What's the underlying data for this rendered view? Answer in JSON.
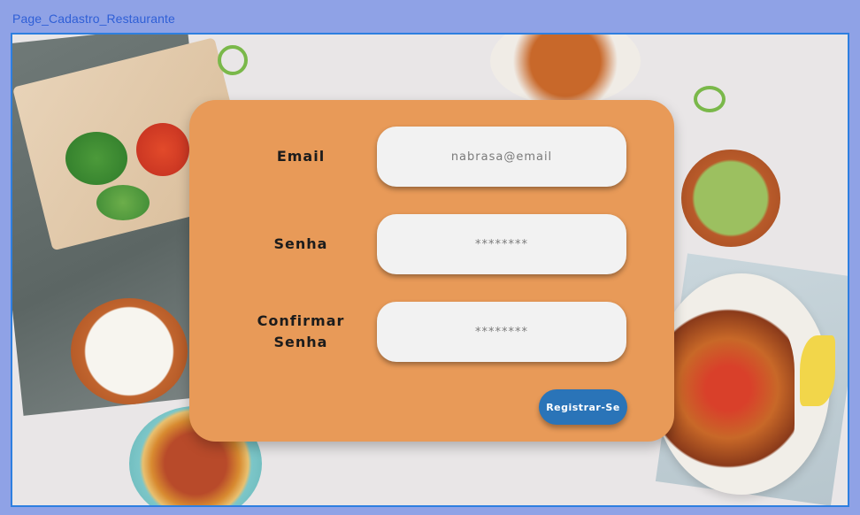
{
  "frame": {
    "label": "Page_Cadastro_Restaurante"
  },
  "form": {
    "email_label": "Email",
    "email_placeholder": "nabrasa@email",
    "password_label": "Senha",
    "password_placeholder": "********",
    "confirm_label_line1": "Confirmar",
    "confirm_label_line2": "Senha",
    "confirm_placeholder": "********",
    "submit_label": "Registrar-Se"
  },
  "colors": {
    "canvas_background": "#8fa2e6",
    "frame_border": "#2e7fe0",
    "card_background": "#e89a58",
    "field_background": "#f2f2f2",
    "button_background": "#2a74b8"
  }
}
